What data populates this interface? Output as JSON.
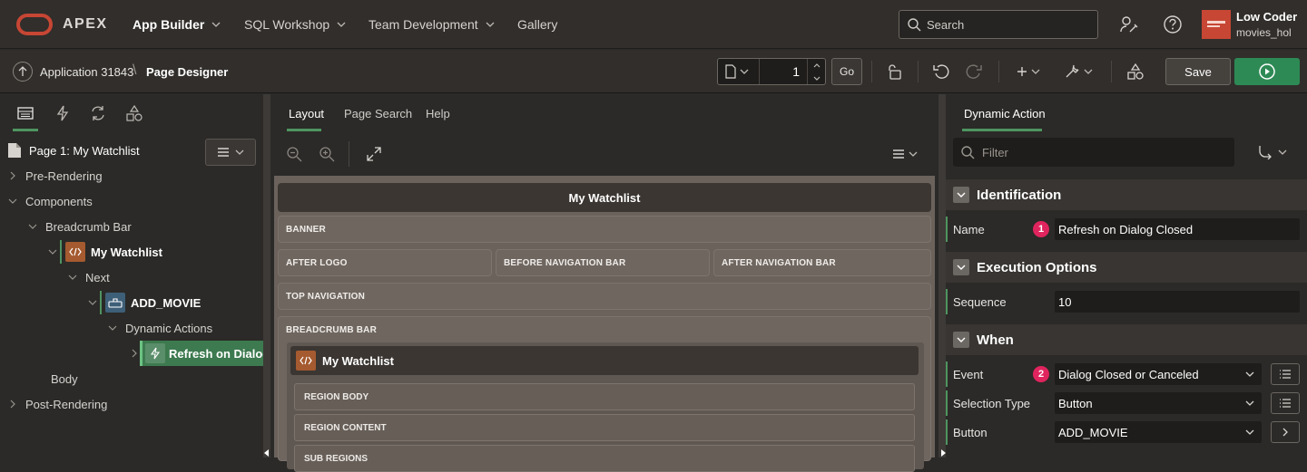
{
  "topbar": {
    "brand": "APEX",
    "nav": [
      "App Builder",
      "SQL Workshop",
      "Team Development",
      "Gallery"
    ],
    "search_placeholder": "Search",
    "user_name": "Low Coder",
    "workspace": "movies_hol"
  },
  "toolbar": {
    "app_crumb": "Application 31843",
    "crumb_separator": "\\",
    "page_crumb": "Page Designer",
    "page_number": "1",
    "go_label": "Go",
    "save_label": "Save"
  },
  "left": {
    "page_title": "Page 1: My Watchlist",
    "tree": [
      "Pre-Rendering",
      "Components",
      "Breadcrumb Bar",
      "My Watchlist",
      "Next",
      "ADD_MOVIE",
      "Dynamic Actions",
      "Refresh on Dialog Closed",
      "Body",
      "Post-Rendering"
    ]
  },
  "middle": {
    "tabs": [
      "Layout",
      "Page Search",
      "Help"
    ],
    "page_title": "My Watchlist",
    "positions": {
      "banner": "BANNER",
      "after_logo": "AFTER LOGO",
      "before_nav": "BEFORE NAVIGATION BAR",
      "after_nav": "AFTER NAVIGATION BAR",
      "top_nav": "TOP NAVIGATION",
      "breadcrumb_bar": "BREADCRUMB BAR"
    },
    "region": {
      "title": "My Watchlist",
      "sub_positions": [
        "REGION BODY",
        "REGION CONTENT",
        "SUB REGIONS"
      ]
    }
  },
  "right": {
    "tab": "Dynamic Action",
    "filter_placeholder": "Filter",
    "groups": {
      "identification": "Identification",
      "execution": "Execution Options",
      "when": "When"
    },
    "props": {
      "name_label": "Name",
      "name_value": "Refresh on Dialog Closed",
      "sequence_label": "Sequence",
      "sequence_value": "10",
      "event_label": "Event",
      "event_value": "Dialog Closed or Canceled",
      "selection_type_label": "Selection Type",
      "selection_type_value": "Button",
      "button_label": "Button",
      "button_value": "ADD_MOVIE"
    },
    "badges": [
      "1",
      "2"
    ]
  },
  "colors": {
    "accent_green": "#4f9460",
    "oracle_red": "#c74634",
    "badge_pink": "#e0245e",
    "run_green": "#2e8a55"
  }
}
